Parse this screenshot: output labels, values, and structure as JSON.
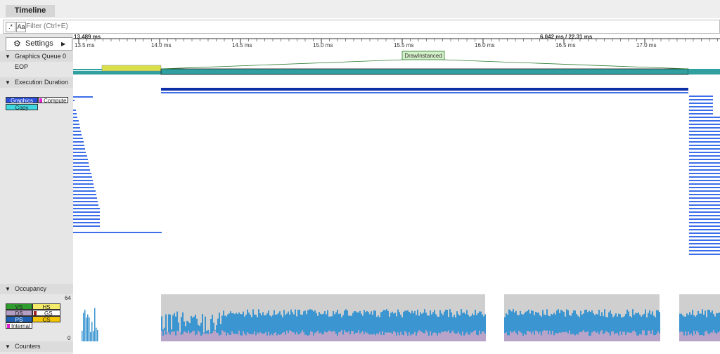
{
  "tab": {
    "label": "Timeline"
  },
  "filter": {
    "regex_label": ".*",
    "case_label": "Aa",
    "placeholder": "Filter (Ctrl+E)"
  },
  "settings": {
    "label": "Settings"
  },
  "ruler": {
    "start_label": "13.489 ms",
    "span_label": "6.042 ms / 22.31 ms",
    "ticks": [
      "13.5 ms",
      "14.0 ms",
      "14.5 ms",
      "15.0 ms",
      "15.5 ms",
      "16.0 ms",
      "16.5 ms",
      "17.0 ms"
    ]
  },
  "rows": {
    "queue": "Graphics Queue 0 EOP",
    "exec": "Execution Duration",
    "occupancy": "Occupancy",
    "counters": "Counters"
  },
  "event": {
    "label": "DrawInstanced"
  },
  "exec_legend": [
    "Graphics",
    "Compute",
    "Copy"
  ],
  "occ_legend": [
    "VS",
    "HS",
    "DS",
    "GS",
    "PS",
    "CS",
    "Internal"
  ],
  "occ_axis": {
    "max": "64",
    "min": "0"
  },
  "colors": {
    "bar_blue": "#3b6ee8",
    "bar_dark": "#0d2fa8",
    "queue_teal": "#2f9f9f",
    "queue_yellow": "#d9e04a",
    "occ_blue": "#3b95d0",
    "occ_purple": "#b7a4c8",
    "occ_gray": "#cfcfcf"
  }
}
